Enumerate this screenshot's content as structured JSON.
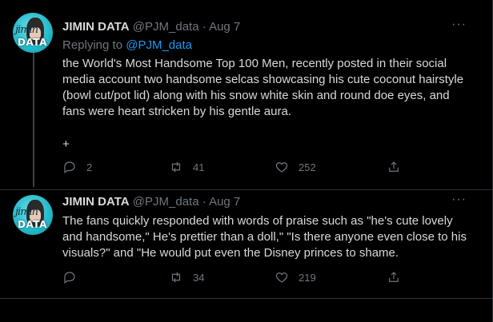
{
  "tweets": [
    {
      "author_name": "JIMIN DATA",
      "handle": "@PJM_data",
      "separator": "·",
      "date": "Aug 7",
      "replying_to_prefix": "Replying to",
      "replying_to_handle": "@PJM_data",
      "text": "the World's Most Handsome Top 100 Men, recently posted in their social media account two handsome selcas showcasing his cute coconut hairstyle (bowl cut/pot lid) along with his snow white skin and round doe eyes, and fans were heart stricken by his gentle aura.",
      "trailing_symbol": "+",
      "reply_count": "2",
      "retweet_count": "41",
      "like_count": "252",
      "avatar_script": "jimin",
      "avatar_brand": "DATA"
    },
    {
      "author_name": "JIMIN DATA",
      "handle": "@PJM_data",
      "separator": "·",
      "date": "Aug 7",
      "text": "The fans quickly responded with words of praise such as \"he's cute lovely and handsome,\" He's prettier than a doll,\" \"Is there anyone even close to his visuals?\" and \"He would put even the Disney princes to shame.",
      "reply_count": "",
      "retweet_count": "34",
      "like_count": "219",
      "avatar_script": "jimin",
      "avatar_brand": "DATA"
    }
  ],
  "more_label": "···",
  "icons": {
    "reply": "reply-icon",
    "retweet": "retweet-icon",
    "like": "heart-icon",
    "share": "share-icon",
    "more": "more-icon"
  },
  "colors": {
    "background": "#000000",
    "text": "#d9d9d9",
    "muted": "#6e767d",
    "link": "#1d9bf0",
    "divider": "#2f3336",
    "avatar": "#22b8c8"
  }
}
